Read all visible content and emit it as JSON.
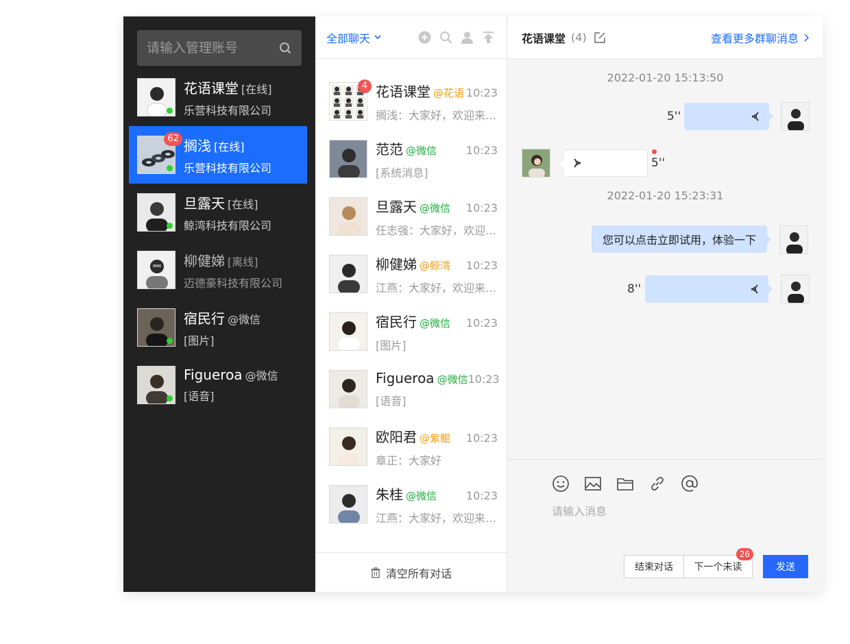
{
  "search": {
    "placeholder": "请输入管理账号"
  },
  "accounts": [
    {
      "name": "花语课堂",
      "tag": "[在线]",
      "sub": "乐营科技有限公司",
      "online": true
    },
    {
      "name": "搁浅",
      "tag": "[在线]",
      "sub": "乐营科技有限公司",
      "online": true,
      "badge": "62",
      "active": true
    },
    {
      "name": "旦露天",
      "tag": "[在线]",
      "sub": "鲸湾科技有限公司",
      "online": true
    },
    {
      "name": "柳健娣",
      "tag": "[离线]",
      "sub": "迈德豪科技有限公司",
      "online": false
    },
    {
      "name": "宿民行",
      "tag": "@微信",
      "sub": "[图片]",
      "online": true
    },
    {
      "name": "Figueroa",
      "tag": "@微信",
      "sub": "[语音]",
      "online": true
    }
  ],
  "conversation_list": {
    "filter_label": "全部聊天",
    "header_icons": [
      "add-icon",
      "search-icon",
      "user-icon",
      "pin-top-icon"
    ],
    "items": [
      {
        "name": "花语课堂",
        "source": "@花语",
        "source_color": "orange",
        "time": "10:23",
        "preview": "搁浅：大家好，欢迎来…",
        "badge": "4"
      },
      {
        "name": "范范",
        "source": "@微信",
        "source_color": "green",
        "time": "10:23",
        "preview": "[系统消息]"
      },
      {
        "name": "旦露天",
        "source": "@微信",
        "source_color": "green",
        "time": "10:23",
        "preview": "任志强：大家好，欢迎…"
      },
      {
        "name": "柳健娣",
        "source": "@鲸湾",
        "source_color": "orange",
        "time": "10:23",
        "preview": "江燕：大家好，欢迎来…"
      },
      {
        "name": "宿民行",
        "source": "@微信",
        "source_color": "green",
        "time": "10:23",
        "preview": "[图片]"
      },
      {
        "name": "Figueroa",
        "source": "@微信",
        "source_color": "green",
        "time": "10:23",
        "preview": "[语音]"
      },
      {
        "name": "欧阳君",
        "source": "@紫鲲",
        "source_color": "orange",
        "time": "10:23",
        "preview": "章正：大家好"
      },
      {
        "name": "朱桂",
        "source": "@微信",
        "source_color": "green",
        "time": "10:23",
        "preview": "江燕：大家好，欢迎来…"
      }
    ],
    "clear_label": "清空所有对话"
  },
  "chat": {
    "title": "花语课堂",
    "count": "(4)",
    "more_label": "查看更多群聊消息",
    "timestamps": [
      "2022-01-20 15:13:50",
      "2022-01-20 15:23:31"
    ],
    "messages": [
      {
        "type": "voice",
        "direction": "out",
        "duration": "5''"
      },
      {
        "type": "voice",
        "direction": "in",
        "duration": "5''",
        "unread": true
      },
      {
        "type": "text",
        "direction": "out",
        "text": "您可以点击立即试用，体验一下"
      },
      {
        "type": "voice",
        "direction": "out",
        "duration": "8''"
      }
    ],
    "composer": {
      "placeholder": "请输入消息",
      "tools": [
        "emoji-icon",
        "image-icon",
        "folder-icon",
        "link-icon",
        "at-icon"
      ],
      "end_label": "结束对话",
      "next_label": "下一个未读",
      "next_badge": "26",
      "send_label": "发送"
    }
  },
  "colors": {
    "accent": "#1a6dff",
    "sidebar": "#222222",
    "online": "#2ad42a",
    "badge": "#f05454",
    "bubble_out": "#cfe2ff"
  }
}
